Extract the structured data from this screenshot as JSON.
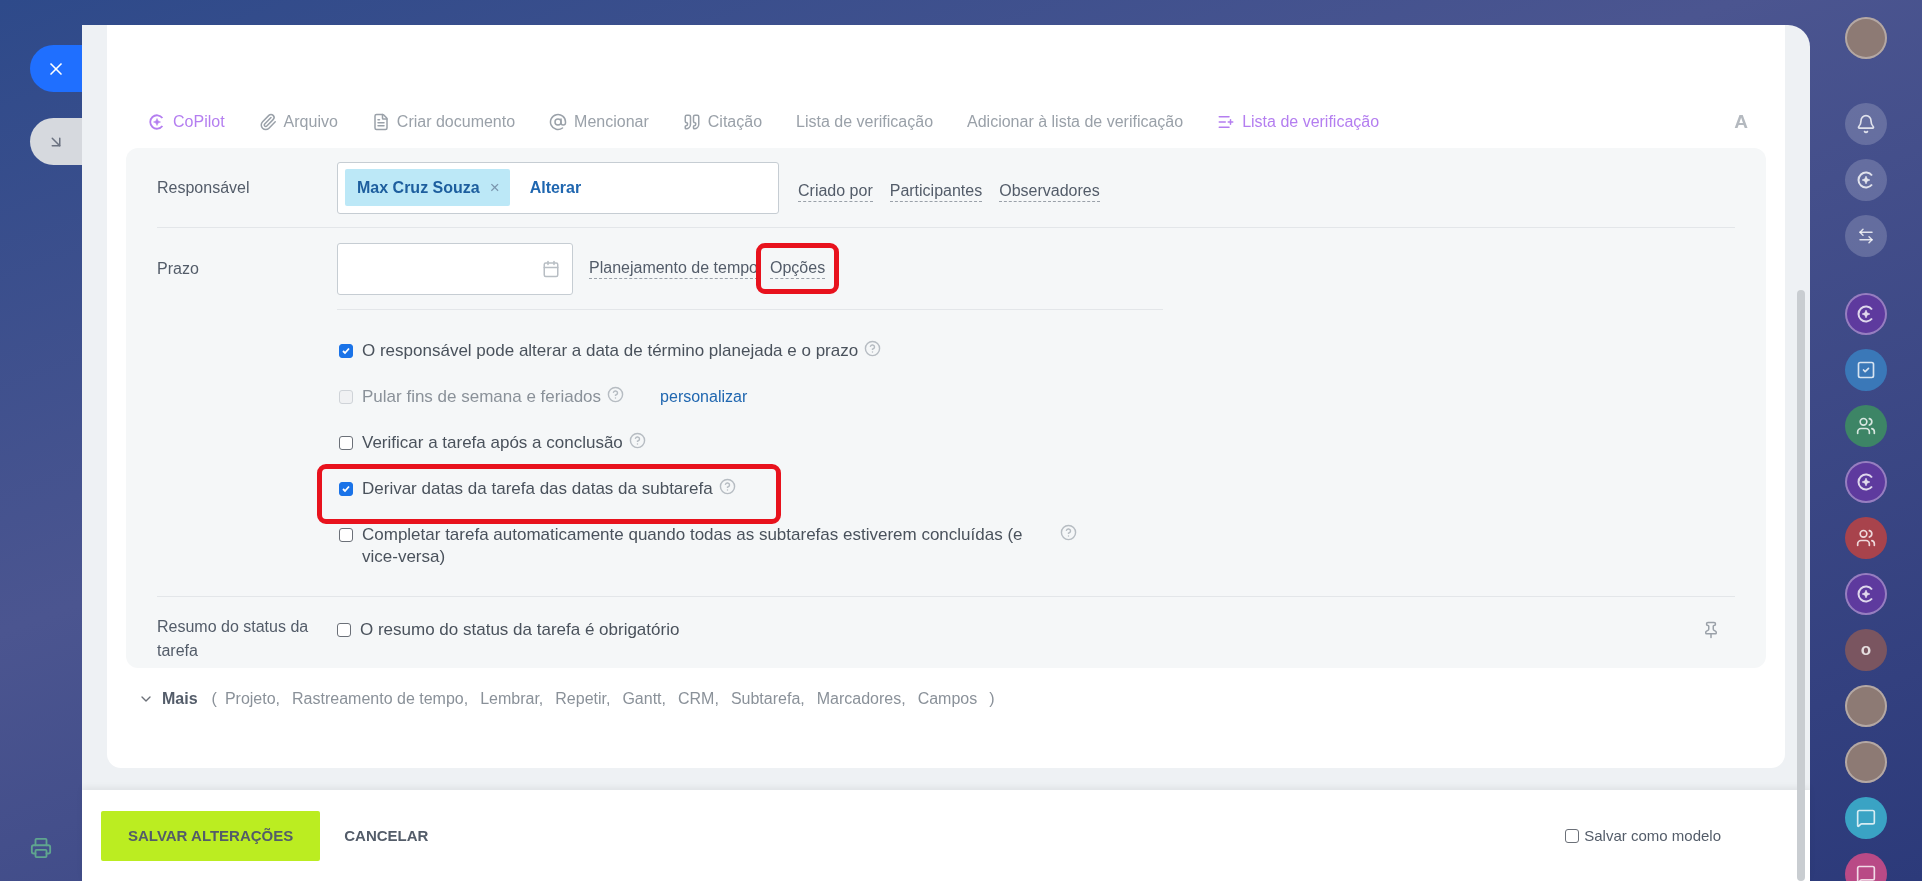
{
  "toolbar": [
    {
      "kind": "copilot",
      "label": "CoPilot",
      "accent": true
    },
    {
      "kind": "attach",
      "label": "Arquivo",
      "accent": false
    },
    {
      "kind": "document",
      "label": "Criar documento",
      "accent": false
    },
    {
      "kind": "mention",
      "label": "Mencionar",
      "accent": false
    },
    {
      "kind": "quote",
      "label": "Citação",
      "accent": false
    },
    {
      "kind": "plain",
      "label": "Lista de verificação",
      "accent": false
    },
    {
      "kind": "plain",
      "label": "Adicionar à lista de verificação",
      "accent": false
    },
    {
      "kind": "checklist",
      "label": "Lista de verificação",
      "accent": true
    }
  ],
  "format_button": "A",
  "responsible": {
    "label": "Responsável",
    "tag": "Max Cruz Souza",
    "tag_remove": "×",
    "change": "Alterar",
    "links": [
      "Criado por",
      "Participantes",
      "Observadores"
    ]
  },
  "deadline": {
    "label": "Prazo",
    "links": [
      {
        "label": "Planejamento de tempo",
        "highlighted": false
      },
      {
        "label": "Opções",
        "highlighted": true
      }
    ]
  },
  "options": [
    {
      "label": "O responsável pode alterar a data de término planejada e o prazo",
      "checked": true,
      "disabled": false,
      "highlighted": false,
      "help": true
    },
    {
      "label": "Pular fins de semana e feriados",
      "checked": false,
      "disabled": true,
      "highlighted": false,
      "help": true,
      "link": "personalizar"
    },
    {
      "label": "Verificar a tarefa após a conclusão",
      "checked": false,
      "disabled": false,
      "highlighted": false,
      "help": true
    },
    {
      "label": "Derivar datas da tarefa das datas da subtarefa",
      "checked": true,
      "disabled": false,
      "highlighted": true,
      "help": true
    },
    {
      "label": "Completar tarefa automaticamente quando todas as subtarefas estiverem concluídas (e vice-versa)",
      "checked": false,
      "disabled": false,
      "highlighted": false,
      "help": true
    }
  ],
  "status_summary": {
    "label": "Resumo do status da tarefa",
    "option": "O resumo do status da tarefa é obrigatório",
    "checked": false
  },
  "more": {
    "label": "Mais",
    "open": "(",
    "items": [
      "Projeto,",
      "Rastreamento de tempo,",
      "Lembrar,",
      "Repetir,",
      "Gantt,",
      "CRM,",
      "Subtarefa,",
      "Marcadores,",
      "Campos"
    ],
    "close": ")"
  },
  "footer": {
    "save": "SALVAR ALTERAÇÕES",
    "cancel": "CANCELAR",
    "template": {
      "label": "Salvar como modelo",
      "checked": false
    }
  },
  "right_rail": [
    {
      "kind": "avatar"
    },
    {
      "kind": "bell"
    },
    {
      "kind": "copilot"
    },
    {
      "kind": "chat"
    },
    {
      "kind": "divider"
    },
    {
      "kind": "copilot-app",
      "color": "#5e3a9e"
    },
    {
      "kind": "task-app",
      "color": "#3a78b8"
    },
    {
      "kind": "group-app",
      "color": "#3d8566"
    },
    {
      "kind": "copilot-app",
      "color": "#5e3a9e"
    },
    {
      "kind": "group-app",
      "color": "#a8434c"
    },
    {
      "kind": "copilot-app",
      "color": "#5e3a9e"
    },
    {
      "kind": "letter",
      "text": "o",
      "color": "#7a5560"
    },
    {
      "kind": "avatar"
    },
    {
      "kind": "avatar"
    },
    {
      "kind": "chat-app",
      "color": "#3aa3c4"
    },
    {
      "kind": "chat-app",
      "color": "#b94a86"
    }
  ]
}
